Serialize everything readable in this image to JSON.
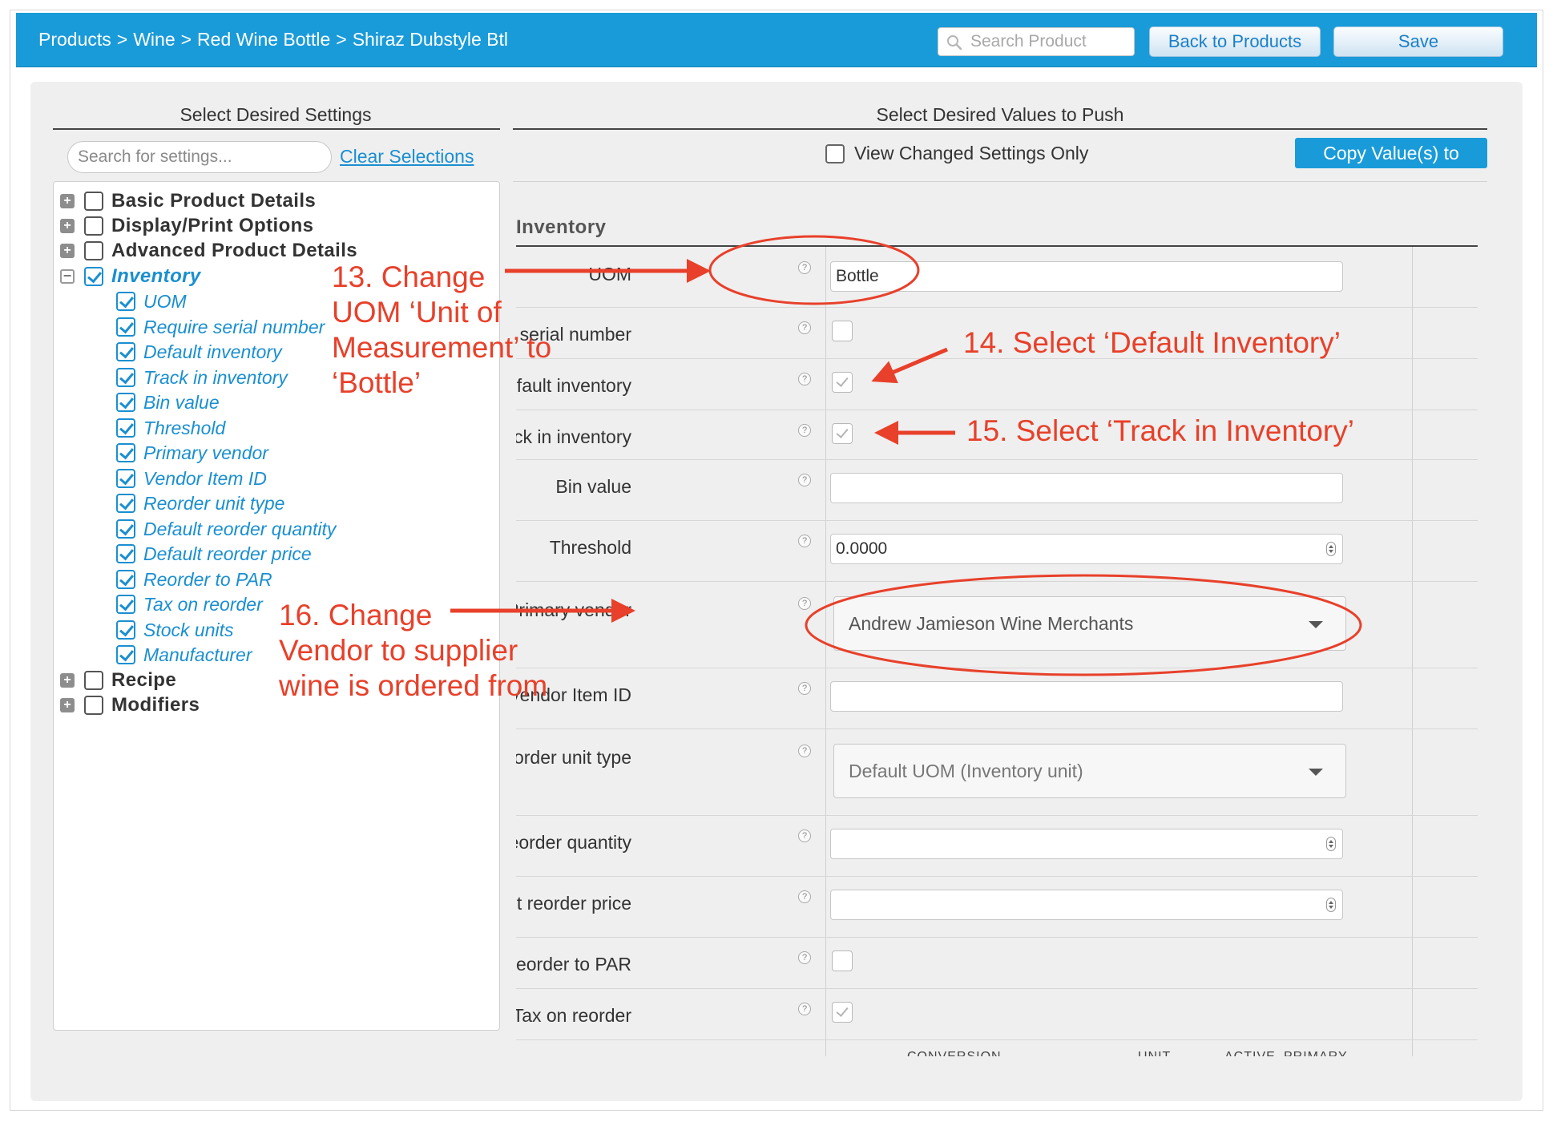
{
  "header": {
    "breadcrumb": [
      "Products",
      "Wine",
      "Red Wine Bottle",
      "Shiraz Dubstyle Btl"
    ],
    "separator": ">",
    "search_placeholder": "Search Product",
    "back_label": "Back to Products",
    "save_label": "Save",
    "accent_color": "#1a9bd9"
  },
  "left_panel": {
    "heading": "Select Desired Settings",
    "search_placeholder": "Search for settings...",
    "clear_label": "Clear Selections",
    "groups": [
      {
        "label": "Basic Product Details",
        "expanded": false,
        "checked": false
      },
      {
        "label": "Display/Print Options",
        "expanded": false,
        "checked": false
      },
      {
        "label": "Advanced Product Details",
        "expanded": false,
        "checked": false
      },
      {
        "label": "Inventory",
        "expanded": true,
        "checked": true
      },
      {
        "label": "Recipe",
        "expanded": false,
        "checked": false
      },
      {
        "label": "Modifiers",
        "expanded": false,
        "checked": false
      }
    ],
    "inventory_items": [
      "UOM",
      "Require serial number",
      "Default inventory",
      "Track in inventory",
      "Bin value",
      "Threshold",
      "Primary vendor",
      "Vendor Item ID",
      "Reorder unit type",
      "Default reorder quantity",
      "Default reorder price",
      "Reorder to PAR",
      "Tax on reorder",
      "Stock units",
      "Manufacturer"
    ]
  },
  "right_panel": {
    "heading": "Select Desired Values to Push",
    "view_changed_label": "View Changed Settings Only",
    "copy_label": "Copy Value(s) to",
    "section_title": "Inventory",
    "help_glyph": "?",
    "fields": {
      "uom": {
        "label": "UOM",
        "value": "Bottle"
      },
      "require_serial": {
        "label": "Require serial number",
        "checked": false
      },
      "default_inventory": {
        "label": "Default inventory",
        "checked": true
      },
      "track_inventory": {
        "label": "Track in inventory",
        "checked": true
      },
      "bin_value": {
        "label": "Bin value",
        "value": ""
      },
      "threshold": {
        "label": "Threshold",
        "value": "0.0000"
      },
      "primary_vendor": {
        "label": "Primary vendor",
        "value": "Andrew Jamieson Wine Merchants"
      },
      "vendor_item_id": {
        "label": "Vendor Item ID",
        "value": ""
      },
      "reorder_unit_type": {
        "label": "Reorder unit type",
        "value": "Default UOM (Inventory unit)"
      },
      "default_reorder_quantity": {
        "label": "Default reorder quantity",
        "value": ""
      },
      "default_reorder_price": {
        "label": "Default reorder price",
        "value": ""
      },
      "reorder_to_par": {
        "label": "Reorder to PAR",
        "checked": false
      },
      "tax_on_reorder": {
        "label": "Tax on reorder",
        "checked": true
      }
    },
    "table_columns": [
      "CONVERSION",
      "UNIT",
      "ACTIVE",
      "PRIMARY"
    ]
  },
  "annotations": {
    "step13": [
      "13. Change",
      "UOM ‘Unit of",
      "Measurement’ to",
      "‘Bottle’"
    ],
    "step14": "14. Select ‘Default Inventory’",
    "step15": "15. Select ‘Track in Inventory’",
    "step16": [
      "16. Change",
      "Vendor to supplier",
      "wine is ordered from"
    ],
    "color": "#e8402a"
  }
}
